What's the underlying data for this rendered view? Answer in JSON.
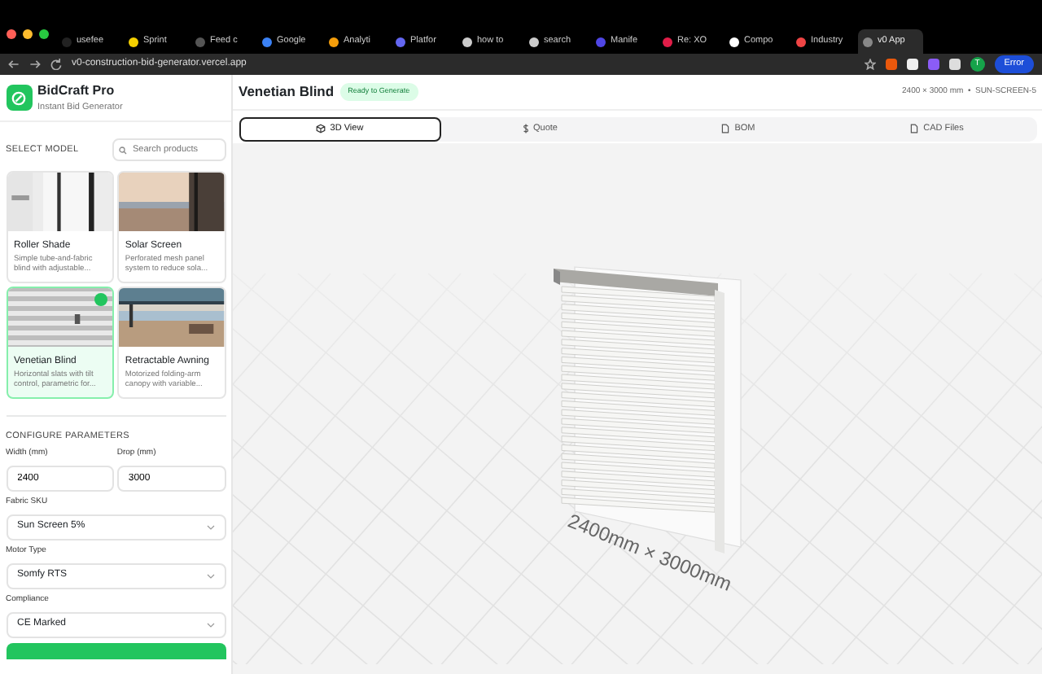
{
  "browser": {
    "tabs": [
      {
        "label": "usefee",
        "selected": false
      },
      {
        "label": "Sprint",
        "selected": false
      },
      {
        "label": "Feed c",
        "selected": false
      },
      {
        "label": "Google",
        "selected": false
      },
      {
        "label": "Analyti",
        "selected": false
      },
      {
        "label": "Platfor",
        "selected": false
      },
      {
        "label": "how to",
        "selected": false
      },
      {
        "label": "search",
        "selected": false
      },
      {
        "label": "Manife",
        "selected": false
      },
      {
        "label": "Re: XO",
        "selected": false
      },
      {
        "label": "Compo",
        "selected": false
      },
      {
        "label": "Industry",
        "selected": false
      },
      {
        "label": "v0 App",
        "selected": true
      }
    ],
    "url": "v0-construction-bid-generator.vercel.app",
    "profile": "T",
    "error_button": "Error"
  },
  "sidebar": {
    "brand": "BidCraft Pro",
    "tagline": "Instant Bid Generator",
    "select_heading": "SELECT MODEL",
    "search": {
      "placeholder": "Search products"
    },
    "models": [
      {
        "name": "Roller Shade",
        "description": "Simple tube-and-fabric blind with adjustable...",
        "selected": false,
        "kind": "picture"
      },
      {
        "name": "Solar Screen",
        "description": "Perforated mesh panel system to reduce sola...",
        "selected": false,
        "kind": "picture"
      },
      {
        "name": "Venetian Blind",
        "description": "Horizontal slats with tilt control, parametric for...",
        "selected": true,
        "kind": "picture"
      },
      {
        "name": "Retractable Awning",
        "description": "Motorized folding-arm canopy with variable...",
        "selected": false,
        "kind": "picture"
      }
    ],
    "configure_heading": "CONFIGURE PARAMETERS",
    "width": {
      "label": "Width (mm)",
      "value": "2400"
    },
    "drop": {
      "label": "Drop (mm)",
      "value": "3000"
    },
    "selects": [
      {
        "label": "Fabric SKU",
        "value": "Sun Screen 5%"
      },
      {
        "label": "Motor Type",
        "value": "Somfy RTS"
      },
      {
        "label": "Compliance",
        "value": "CE Marked"
      }
    ]
  },
  "main": {
    "title": "Venetian Blind",
    "status": "Ready to Generate",
    "summary": "2400 × 3000 mm  •  SUN-SCREEN-5",
    "tabs": [
      {
        "label": "3D View",
        "selected": true
      },
      {
        "label": "Quote",
        "selected": false
      },
      {
        "label": "BOM",
        "selected": false
      },
      {
        "label": "CAD Files",
        "selected": false
      }
    ],
    "dimension_label": "2400mm × 3000mm"
  }
}
